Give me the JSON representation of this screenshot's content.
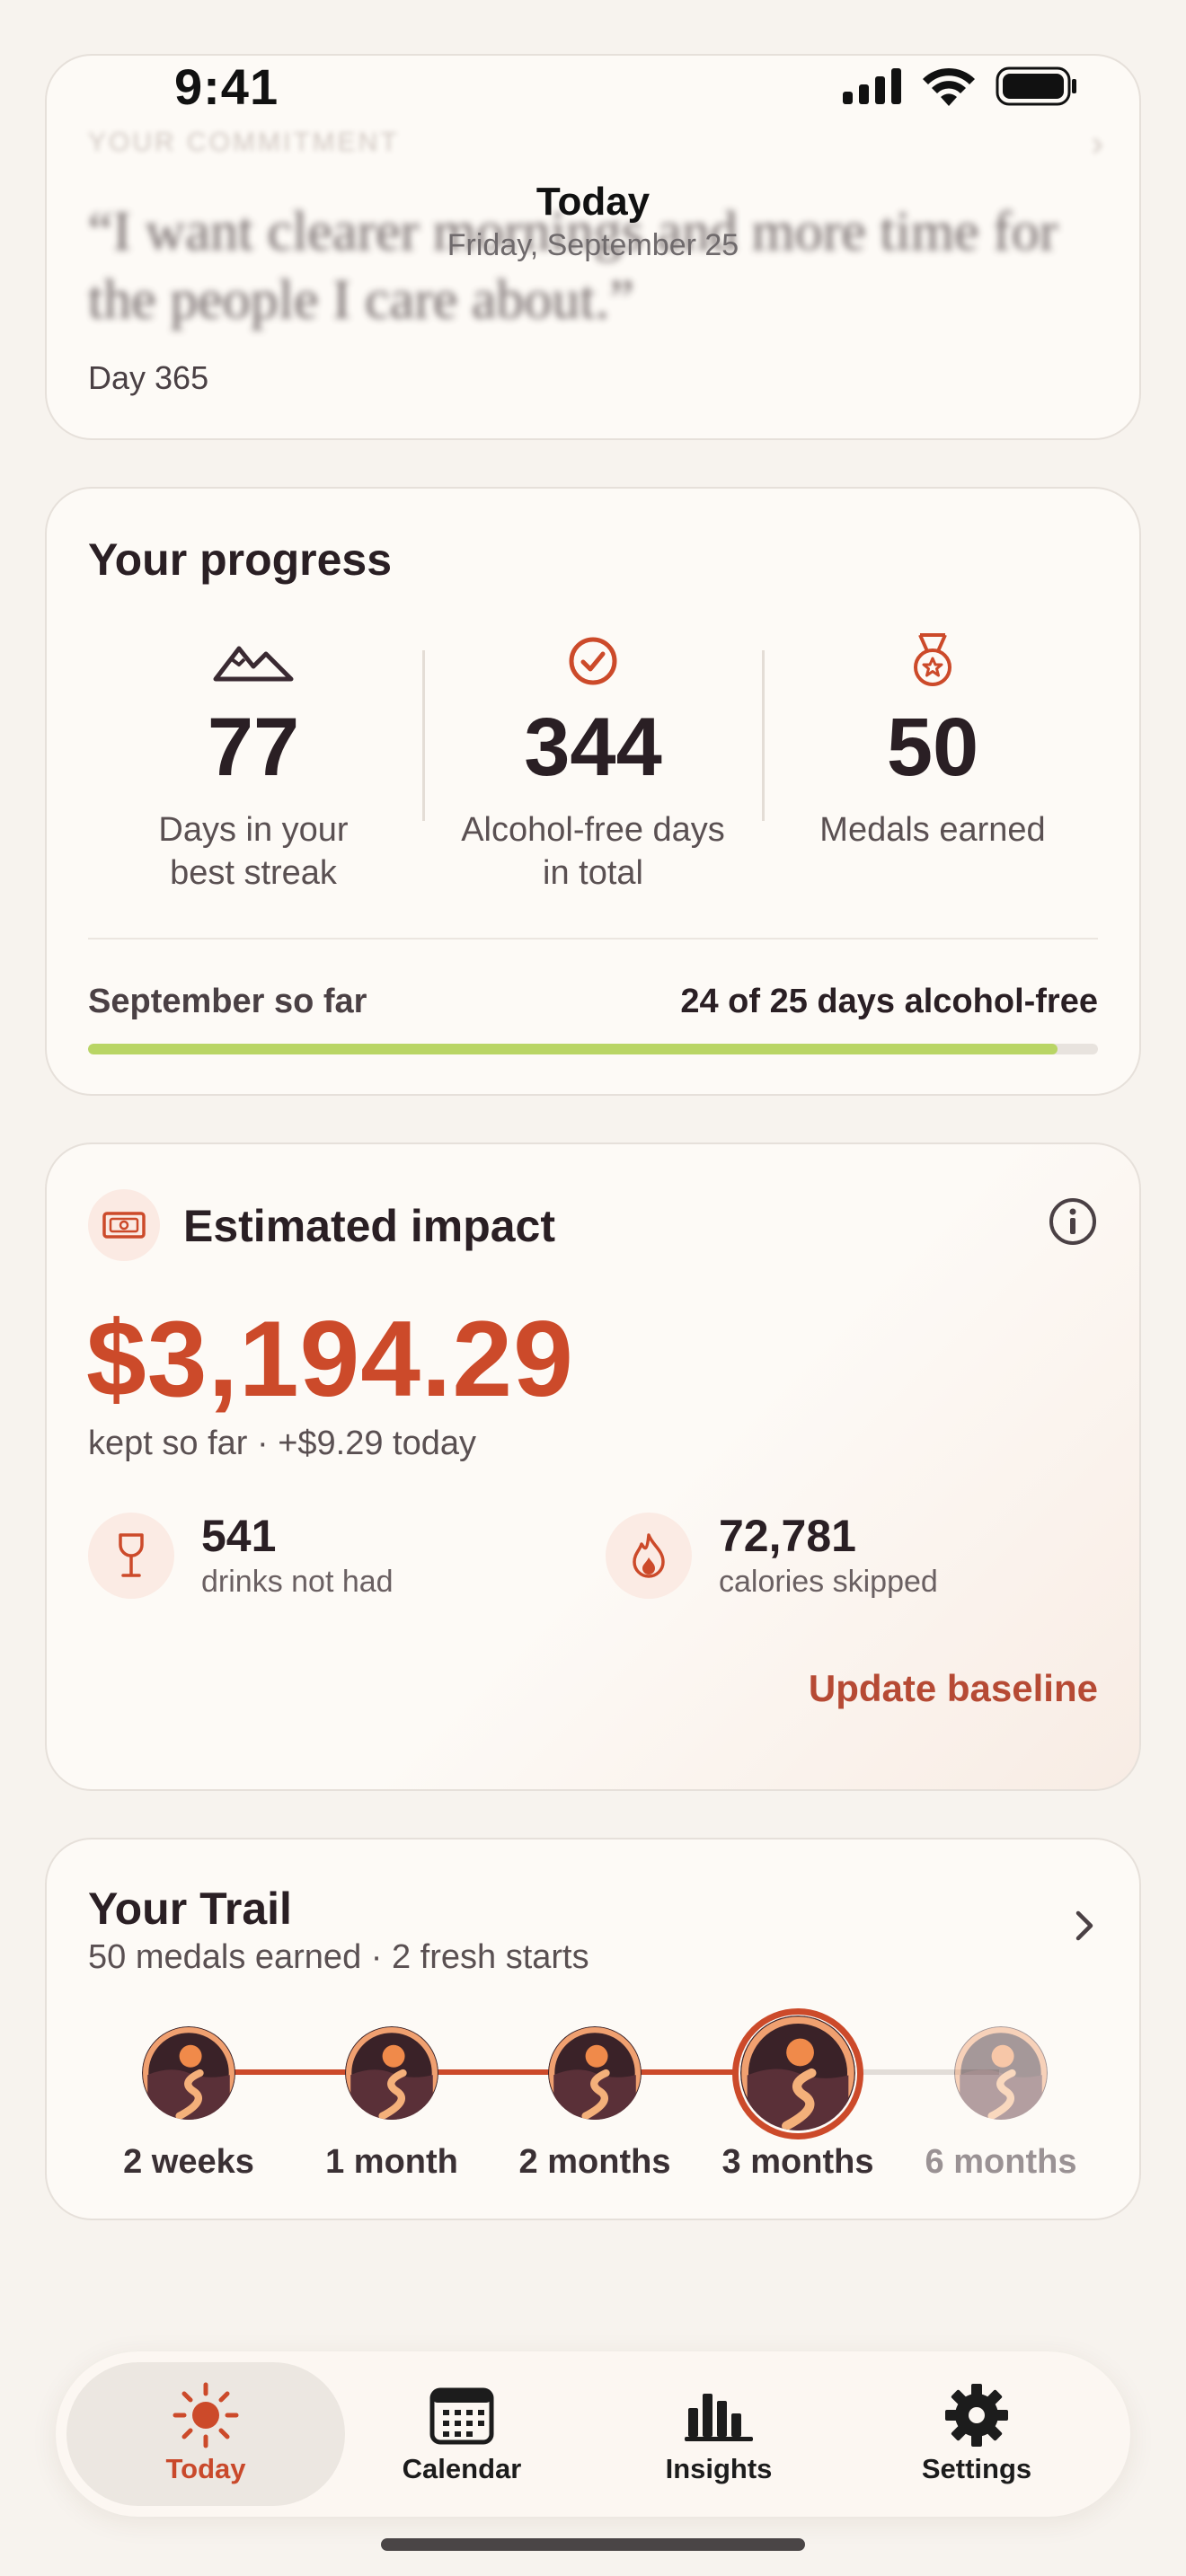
{
  "status_bar": {
    "time": "9:41"
  },
  "header": {
    "title": "Today",
    "subtitle": "Friday, September 25"
  },
  "commitment": {
    "eyebrow": "YOUR COMMITMENT",
    "quote": "“I want clearer mornings and more time for the people I care about.”",
    "day": "Day 365"
  },
  "progress": {
    "title": "Your progress",
    "stats": [
      {
        "icon": "mountains-icon",
        "value": "77",
        "label_line1": "Days in your",
        "label_line2": "best streak"
      },
      {
        "icon": "check-circle-icon",
        "value": "344",
        "label_line1": "Alcohol-free days",
        "label_line2": "in total"
      },
      {
        "icon": "medal-icon",
        "value": "50",
        "label_line1": "Medals earned",
        "label_line2": ""
      }
    ],
    "month_label": "September so far",
    "month_value": "24 of 25 days alcohol-free",
    "month_fraction": 0.96
  },
  "impact": {
    "icon": "money-icon",
    "title": "Estimated impact",
    "amount": "$3,194.29",
    "subtitle": "kept so far · +$9.29 today",
    "drinks": {
      "icon": "wine-glass-icon",
      "value": "541",
      "label": "drinks not had"
    },
    "calories": {
      "icon": "flame-icon",
      "value": "72,781",
      "label": "calories skipped"
    },
    "update_label": "Update baseline"
  },
  "trail": {
    "title": "Your Trail",
    "subtitle": "50 medals earned · 2 fresh starts",
    "milestones": [
      {
        "label": "2 weeks",
        "state": "earned"
      },
      {
        "label": "1 month",
        "state": "earned"
      },
      {
        "label": "2 months",
        "state": "earned"
      },
      {
        "label": "3 months",
        "state": "current"
      },
      {
        "label": "6 months",
        "state": "locked"
      }
    ]
  },
  "tabs": [
    {
      "label": "Today",
      "icon": "sun-icon",
      "active": true
    },
    {
      "label": "Calendar",
      "icon": "calendar-icon",
      "active": false
    },
    {
      "label": "Insights",
      "icon": "bar-chart-icon",
      "active": false
    },
    {
      "label": "Settings",
      "icon": "gear-icon",
      "active": false
    }
  ],
  "colors": {
    "accent": "#cc4a2a",
    "progress_fill": "#b9d565",
    "background": "#f7f3ee",
    "card": "#fdfaf6"
  }
}
